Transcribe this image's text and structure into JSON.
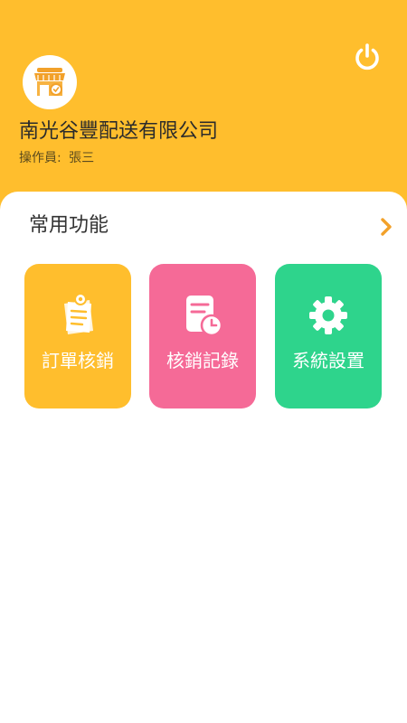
{
  "header": {
    "company_name": "南光谷豐配送有限公司",
    "operator_label": "操作員:",
    "operator_name": "張三",
    "avatar_icon": "store-icon",
    "logout_icon": "power-icon"
  },
  "section": {
    "title": "常用功能",
    "more_icon": "chevron-right-icon"
  },
  "functions": [
    {
      "label": "訂單核銷",
      "icon": "order-verify-icon",
      "color": "#FFBE2D"
    },
    {
      "label": "核銷記錄",
      "icon": "record-clock-icon",
      "color": "#F56A97"
    },
    {
      "label": "系統設置",
      "icon": "gear-icon",
      "color": "#2ED48C"
    }
  ],
  "colors": {
    "primary": "#FFBE2D",
    "accent_orange": "#F2A12A"
  }
}
